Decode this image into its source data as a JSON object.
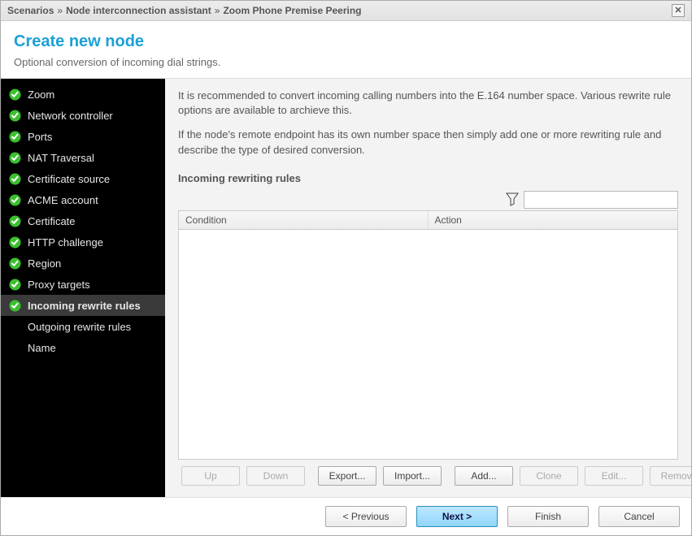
{
  "breadcrumb": {
    "item1": "Scenarios",
    "item2": "Node interconnection assistant",
    "item3": "Zoom Phone Premise Peering"
  },
  "close_glyph": "✕",
  "header": {
    "title": "Create new node",
    "subtitle": "Optional conversion of incoming dial strings."
  },
  "sidebar": {
    "items": [
      {
        "label": "Zoom",
        "done": true,
        "active": false
      },
      {
        "label": "Network controller",
        "done": true,
        "active": false
      },
      {
        "label": "Ports",
        "done": true,
        "active": false
      },
      {
        "label": "NAT Traversal",
        "done": true,
        "active": false
      },
      {
        "label": "Certificate source",
        "done": true,
        "active": false
      },
      {
        "label": "ACME account",
        "done": true,
        "active": false
      },
      {
        "label": "Certificate",
        "done": true,
        "active": false
      },
      {
        "label": "HTTP challenge",
        "done": true,
        "active": false
      },
      {
        "label": "Region",
        "done": true,
        "active": false
      },
      {
        "label": "Proxy targets",
        "done": true,
        "active": false
      },
      {
        "label": "Incoming rewrite rules",
        "done": true,
        "active": true
      },
      {
        "label": "Outgoing rewrite rules",
        "done": false,
        "active": false
      },
      {
        "label": "Name",
        "done": false,
        "active": false
      }
    ]
  },
  "main": {
    "para1": "It is recommended to convert incoming calling numbers into the E.164 number space. Various rewrite rule options are available to archieve this.",
    "para2": "If the node's remote endpoint has its own number space then simply add one or more rewriting rule and describe the type of desired conversion.",
    "section_title": "Incoming rewriting rules",
    "filter_value": "",
    "columns": {
      "condition": "Condition",
      "action": "Action"
    },
    "rows": []
  },
  "table_buttons": {
    "up": "Up",
    "down": "Down",
    "export": "Export...",
    "import": "Import...",
    "add": "Add...",
    "clone": "Clone",
    "edit": "Edit...",
    "remove": "Remove"
  },
  "footer": {
    "previous": "< Previous",
    "next": "Next >",
    "finish": "Finish",
    "cancel": "Cancel"
  }
}
